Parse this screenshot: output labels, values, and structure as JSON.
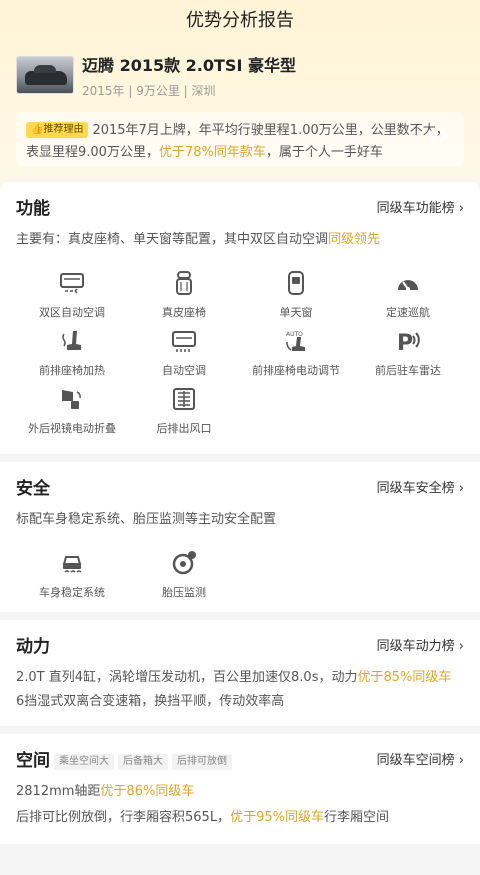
{
  "header": {
    "title": "优势分析报告"
  },
  "car": {
    "name": "迈腾 2015款 2.0TSI 豪华型",
    "meta": "2015年 | 9万公里 | 深圳"
  },
  "recommend": {
    "badge": "推荐理由",
    "text_a": "2015年7月上牌，年平均行驶里程1.00万公里，公里数不大，表显里程9.00万公里，",
    "highlight": "优于78%同年款车",
    "text_b": "，属于个人一手好车"
  },
  "function": {
    "title": "功能",
    "link": "同级车功能榜 ›",
    "desc_a": "主要有：真皮座椅、单天窗等配置，其中双区自动空调",
    "desc_hl": "同级领先",
    "items": [
      {
        "label": "双区自动空调",
        "icon": "dual-zone-ac-icon"
      },
      {
        "label": "真皮座椅",
        "icon": "leather-seat-icon"
      },
      {
        "label": "单天窗",
        "icon": "sunroof-icon"
      },
      {
        "label": "定速巡航",
        "icon": "cruise-control-icon"
      },
      {
        "label": "前排座椅加热",
        "icon": "seat-heating-icon"
      },
      {
        "label": "自动空调",
        "icon": "auto-ac-icon"
      },
      {
        "label": "前排座椅电动调节",
        "icon": "power-seat-icon"
      },
      {
        "label": "前后驻车雷达",
        "icon": "parking-radar-icon"
      },
      {
        "label": "外后视镜电动折叠",
        "icon": "mirror-fold-icon"
      },
      {
        "label": "后排出风口",
        "icon": "rear-vent-icon"
      }
    ]
  },
  "safety": {
    "title": "安全",
    "link": "同级车安全榜 ›",
    "desc": "标配车身稳定系统、胎压监测等主动安全配置",
    "items": [
      {
        "label": "车身稳定系统",
        "icon": "stability-control-icon"
      },
      {
        "label": "胎压监测",
        "icon": "tire-pressure-icon"
      }
    ]
  },
  "power": {
    "title": "动力",
    "link": "同级车动力榜 ›",
    "line1_a": "2.0T 直列4缸，涡轮增压发动机，百公里加速仅8.0s，动力",
    "line1_hl": "优于85%同级车",
    "line2": "6挡湿式双离合变速箱，换挡平顺，传动效率高"
  },
  "space": {
    "title": "空间",
    "tags": [
      "乘坐空间大",
      "后备箱大",
      "后排可放倒"
    ],
    "link": "同级车空间榜 ›",
    "line1_a": "2812mm轴距",
    "line1_hl": "优于86%同级车",
    "line2_a": "后排可比例放倒，行李厢容积565L，",
    "line2_hl": "优于95%同级车",
    "line2_b": "行李厢空间"
  }
}
